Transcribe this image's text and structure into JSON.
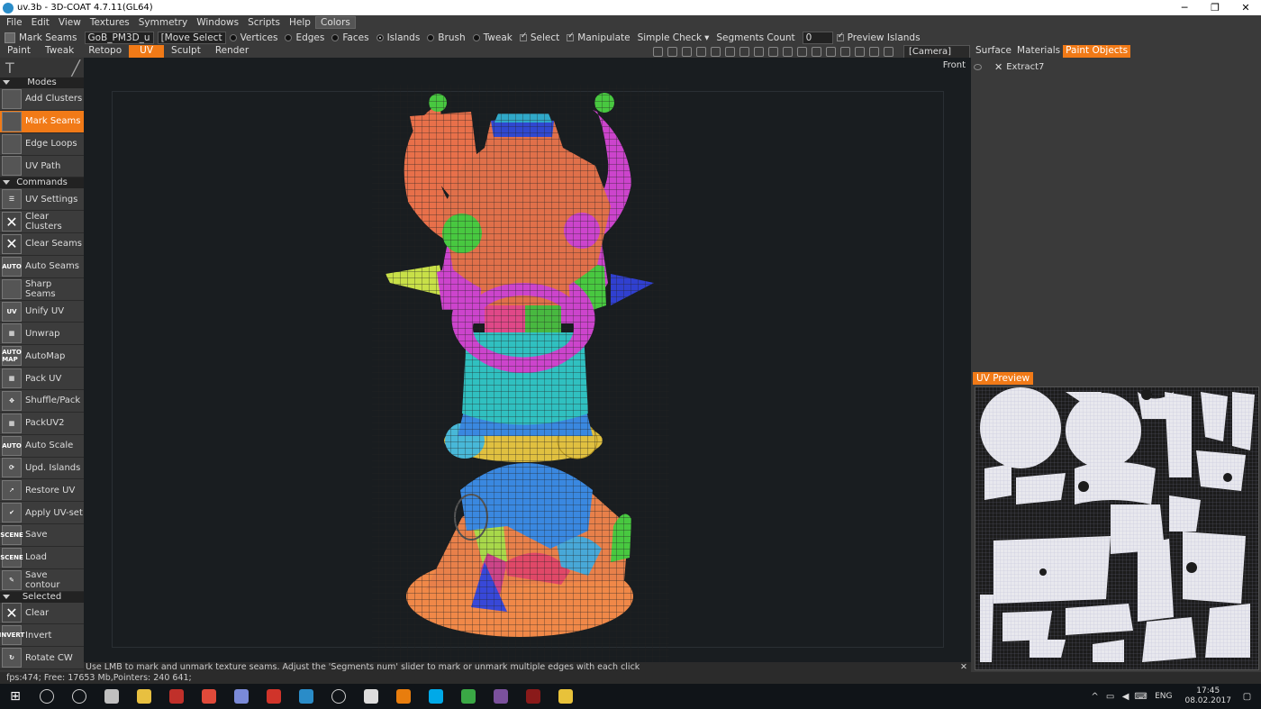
{
  "window": {
    "title": "uv.3b - 3D-COAT 4.7.11(GL64)",
    "controls": [
      "─",
      "❐",
      "✕"
    ]
  },
  "menu": [
    "File",
    "Edit",
    "View",
    "Textures",
    "Symmetry",
    "Windows",
    "Scripts",
    "Help",
    "Colors"
  ],
  "toolbar": {
    "tool_label": "Mark Seams",
    "preset": "GoB_PM3D_u",
    "move_select": "[Move Select",
    "vertices": "Vertices",
    "edges": "Edges",
    "faces": "Faces",
    "islands": "Islands",
    "brush": "Brush",
    "tweak": "Tweak",
    "select": "Select",
    "manipulate": "Manipulate",
    "simple_check": "Simple Check",
    "segments_count": "Segments Count",
    "segments_value": "0",
    "preview_islands": "Preview Islands"
  },
  "room_tabs": [
    "Paint",
    "Tweak",
    "Retopo",
    "UV",
    "Sculpt",
    "Render"
  ],
  "active_room": "UV",
  "camera": "[Camera]",
  "sidebar": {
    "modes_header": "Modes",
    "modes": [
      {
        "label": "Add Clusters",
        "icon": "cube-icon"
      },
      {
        "label": "Mark Seams",
        "icon": "cube-icon",
        "active": true
      },
      {
        "label": "Edge Loops",
        "icon": "cube-icon"
      },
      {
        "label": "UV Path",
        "icon": "cube-icon"
      }
    ],
    "commands_header": "Commands",
    "commands": [
      {
        "label": "UV Settings",
        "icon": "settings-icon",
        "glyph": "☰"
      },
      {
        "label": "Clear Clusters",
        "icon": "clear-icon",
        "glyph": "✕"
      },
      {
        "label": "Clear Seams",
        "icon": "clear-icon",
        "glyph": "✕"
      },
      {
        "label": "Auto Seams",
        "icon": "auto-icon",
        "glyph": "AUTO"
      },
      {
        "label": "Sharp Seams",
        "icon": "cube-icon",
        "glyph": ""
      },
      {
        "label": "Unify UV",
        "icon": "uv-icon",
        "glyph": "UV"
      },
      {
        "label": "Unwrap",
        "icon": "grid-icon",
        "glyph": "▦"
      },
      {
        "label": "AutoMap",
        "icon": "automap-icon",
        "glyph": "AUTO MAP"
      },
      {
        "label": "Pack UV",
        "icon": "grid-icon",
        "glyph": "▦"
      },
      {
        "label": "Shuffle/Pack",
        "icon": "move-icon",
        "glyph": "✥"
      },
      {
        "label": "PackUV2",
        "icon": "grid-icon",
        "glyph": "▦"
      },
      {
        "label": "Auto Scale",
        "icon": "auto-icon",
        "glyph": "AUTO"
      },
      {
        "label": "Upd. Islands",
        "icon": "refresh-icon",
        "glyph": "⟳"
      },
      {
        "label": "Restore UV",
        "icon": "arrow-icon",
        "glyph": "➚"
      },
      {
        "label": "Apply UV-set",
        "icon": "check-icon",
        "glyph": "✔"
      },
      {
        "label": "Save",
        "icon": "scene-icon",
        "glyph": "SCENE"
      },
      {
        "label": "Load",
        "icon": "scene-icon",
        "glyph": "SCENE"
      },
      {
        "label": "Save contour",
        "icon": "brush-icon",
        "glyph": "✎"
      }
    ],
    "selected_header": "Selected",
    "selected": [
      {
        "label": "Clear",
        "icon": "clear-icon",
        "glyph": "✕"
      },
      {
        "label": "Invert",
        "icon": "invert-icon",
        "glyph": "INVERT"
      },
      {
        "label": "Rotate CW",
        "icon": "rotate-icon",
        "glyph": "↻"
      }
    ]
  },
  "viewport": {
    "view_label": "Front"
  },
  "right_panel": {
    "tabs": [
      "Surface",
      "Materials",
      "Paint Objects"
    ],
    "active_tab": "Paint Objects",
    "layer": "Extract7",
    "uv_preview_label": "UV Preview"
  },
  "status_text": "Use LMB to mark and unmark texture seams. Adjust the 'Segments num' slider to mark or unmark multiple edges with each click",
  "fps_text": "fps:474;   Free: 17653 Mb,Pointers: 240  641;",
  "taskbar": {
    "apps": [
      {
        "name": "search-icon",
        "color": "#101418"
      },
      {
        "name": "task-view-icon",
        "color": "#101418"
      },
      {
        "name": "app-icon",
        "color": "#c0c0c0"
      },
      {
        "name": "app-icon",
        "color": "#e8c040"
      },
      {
        "name": "app-icon",
        "color": "#c0302a"
      },
      {
        "name": "chrome-icon",
        "color": "#e04a3a"
      },
      {
        "name": "app-icon",
        "color": "#7a8ad8"
      },
      {
        "name": "app-icon",
        "color": "#d0342a"
      },
      {
        "name": "3dcoat-icon",
        "color": "#2a8cc8"
      },
      {
        "name": "app-icon",
        "color": "#101418"
      },
      {
        "name": "app-icon",
        "color": "#dddddd"
      },
      {
        "name": "blender-icon",
        "color": "#e87d0d"
      },
      {
        "name": "skype-icon",
        "color": "#00a9e8"
      },
      {
        "name": "app-icon",
        "color": "#3aa845"
      },
      {
        "name": "viber-icon",
        "color": "#7b519d"
      },
      {
        "name": "app-icon",
        "color": "#8a1a1a"
      },
      {
        "name": "folder-icon",
        "color": "#e8c23a"
      }
    ],
    "lang": "ENG",
    "time": "17:45",
    "date": "08.02.2017"
  },
  "colors": {
    "accent": "#f17a17",
    "viewport": "#191d20"
  }
}
